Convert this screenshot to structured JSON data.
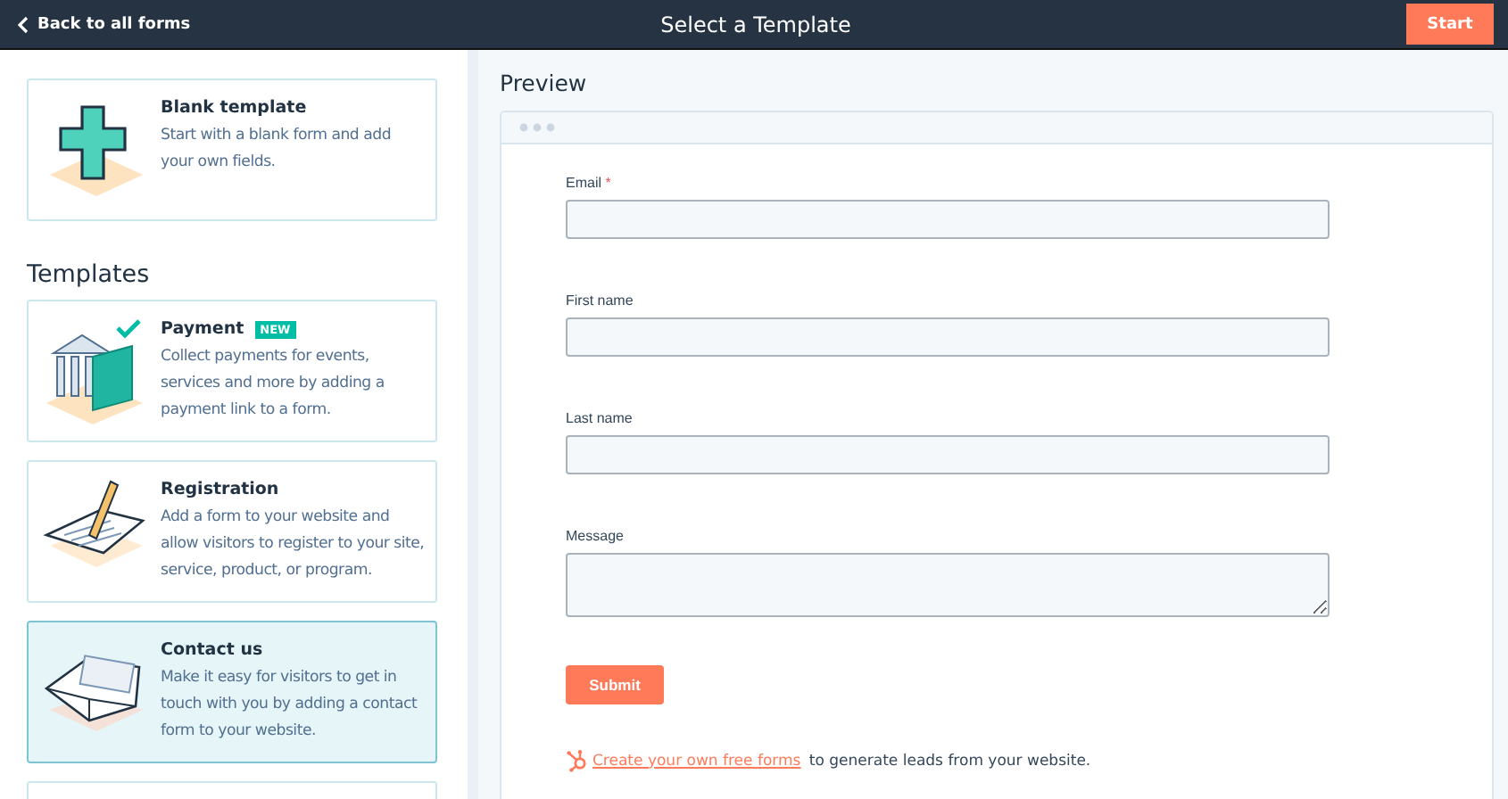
{
  "topbar": {
    "back": "Back to all forms",
    "title": "Select a Template",
    "start": "Start"
  },
  "blank": {
    "kind": "plus",
    "title": "Blank template",
    "description": "Start with a blank form and add your own fields.",
    "selected": false
  },
  "templates_heading": "Templates",
  "templates": [
    {
      "kind": "bank",
      "title": "Payment",
      "badge": "NEW",
      "description": "Collect payments for events, services and more by adding a payment link to a form.",
      "selected": false
    },
    {
      "kind": "pencil",
      "title": "Registration",
      "description": "Add a form to your website and allow visitors to register to your site, service, product, or program.",
      "selected": false
    },
    {
      "kind": "envelope",
      "title": "Contact us",
      "description": "Make it easy for visitors to get in touch with you by adding a contact form to your website.",
      "selected": true
    },
    {
      "kind": "empty",
      "selected": false
    }
  ],
  "preview": {
    "heading": "Preview",
    "fields": [
      {
        "kind": "input",
        "label": "Email",
        "required_mark": "*"
      },
      {
        "kind": "input",
        "label": "First name"
      },
      {
        "kind": "input",
        "label": "Last name"
      },
      {
        "kind": "textarea",
        "label": "Message"
      }
    ],
    "submit": "Submit",
    "promo_link": "Create your own free forms",
    "promo_text": " to generate leads from your website."
  }
}
